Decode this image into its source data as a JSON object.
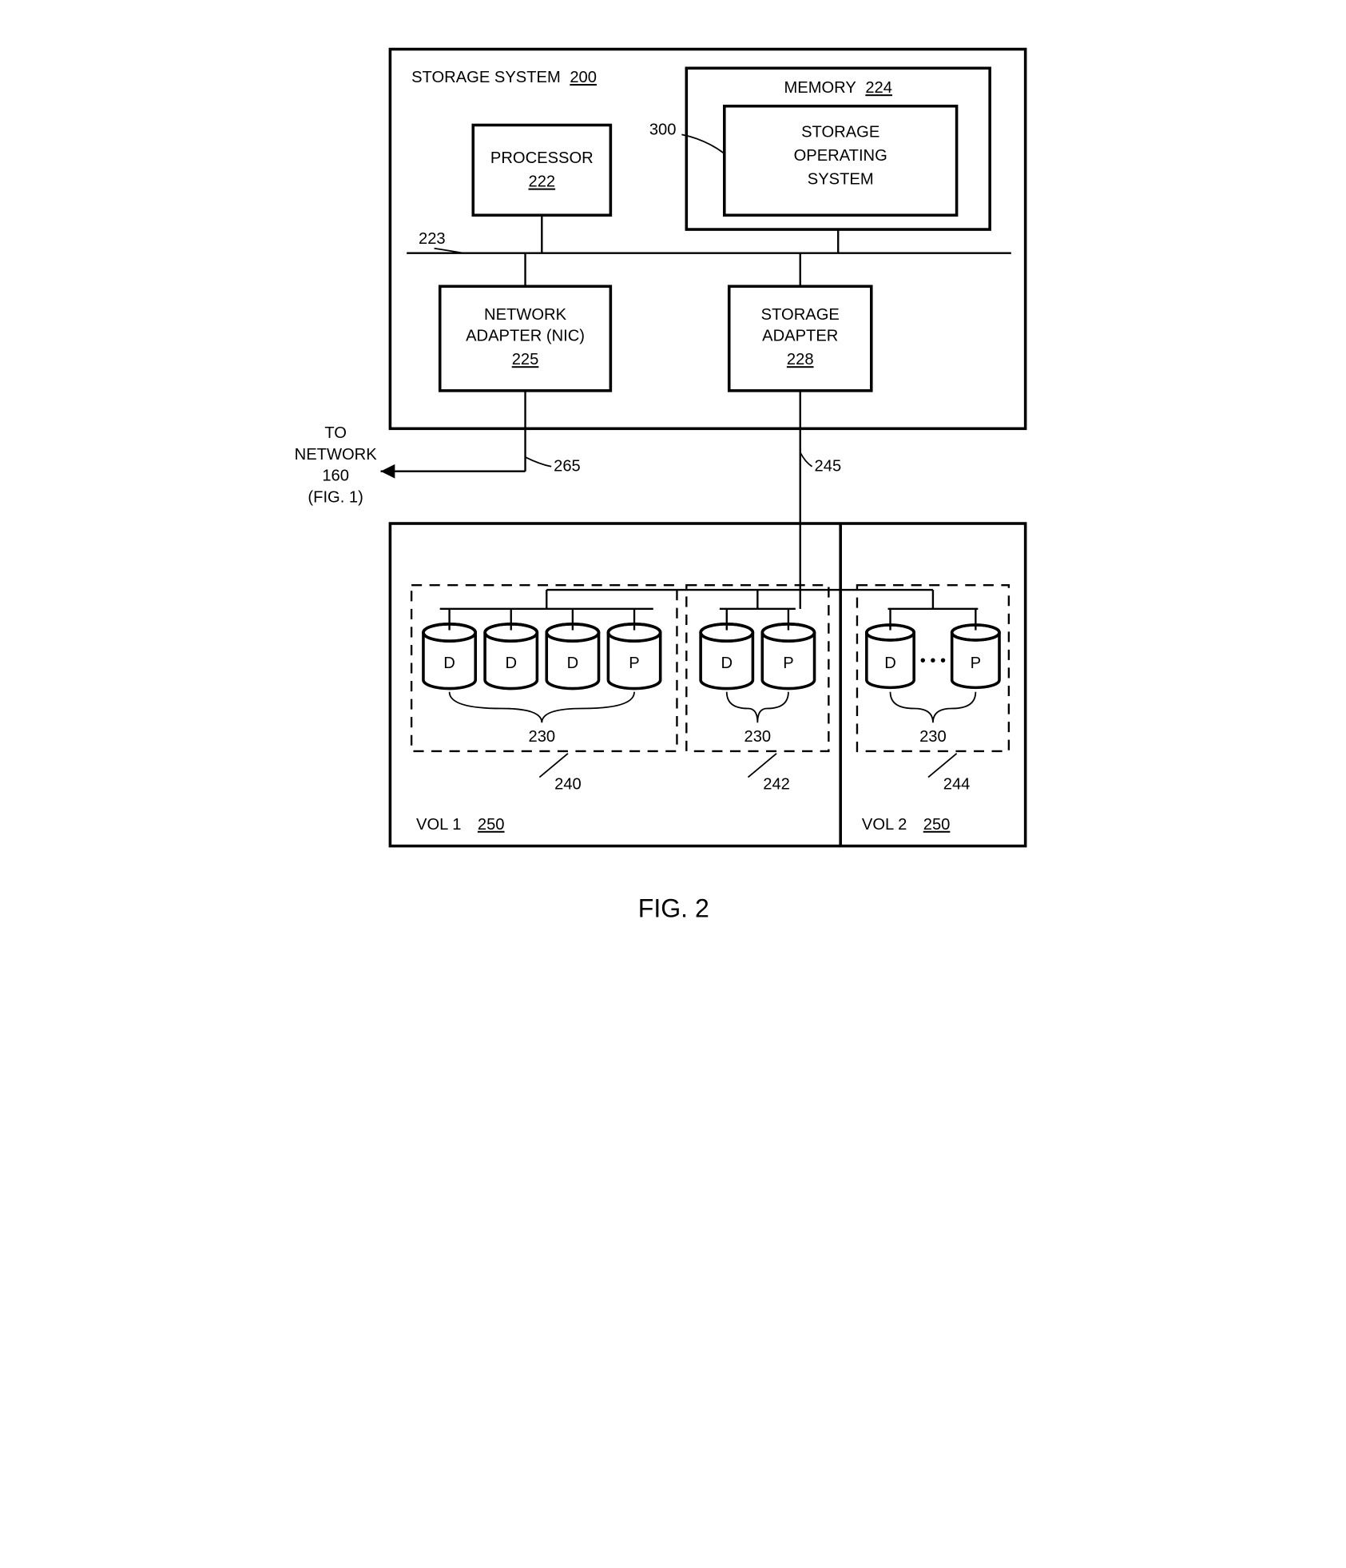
{
  "title": "FIG. 2",
  "storageSystem": {
    "label": "STORAGE SYSTEM",
    "ref": "200"
  },
  "processor": {
    "label": "PROCESSOR",
    "ref": "222"
  },
  "memory": {
    "label": "MEMORY",
    "ref": "224"
  },
  "sos": {
    "label1": "STORAGE",
    "label2": "OPERATING",
    "label3": "SYSTEM",
    "ref": "300"
  },
  "bus": {
    "ref": "223"
  },
  "nic": {
    "label1": "NETWORK",
    "label2": "ADAPTER (NIC)",
    "ref": "225"
  },
  "sadapter": {
    "label1": "STORAGE",
    "label2": "ADAPTER",
    "ref": "228"
  },
  "toNetwork": {
    "l1": "TO",
    "l2": "NETWORK",
    "l3": "160",
    "l4": "(FIG. 1)"
  },
  "c265": "265",
  "c245": "245",
  "group240": {
    "disks": [
      "D",
      "D",
      "D",
      "P"
    ],
    "ref230": "230",
    "ref": "240"
  },
  "group242": {
    "disks": [
      "D",
      "P"
    ],
    "ref230": "230",
    "ref": "242"
  },
  "group244": {
    "disks": [
      "D",
      "P"
    ],
    "ref230": "230",
    "ref": "244",
    "dots": "• • •"
  },
  "vol1": {
    "label": "VOL 1",
    "ref": "250"
  },
  "vol2": {
    "label": "VOL 2",
    "ref": "250"
  }
}
